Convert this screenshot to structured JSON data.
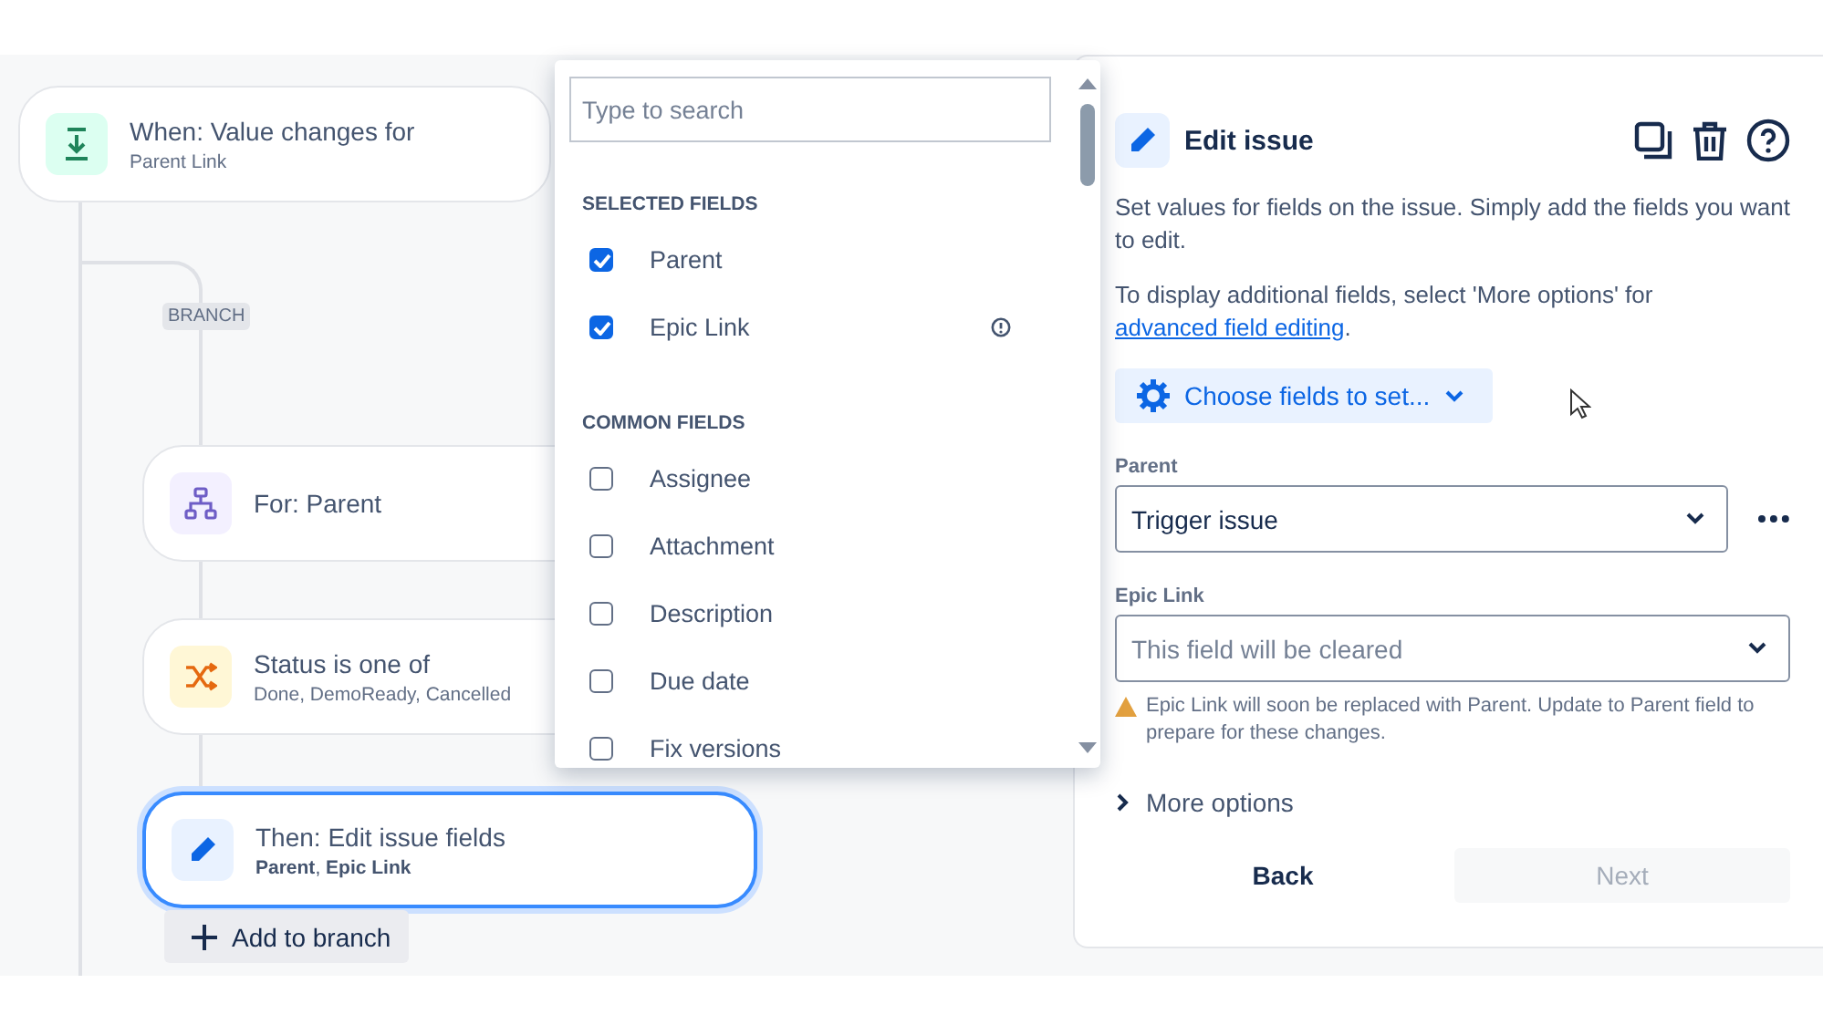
{
  "flow": {
    "trigger": {
      "title": "When: Value changes for",
      "subtitle": "Parent Link"
    },
    "branch_label": "BRANCH",
    "steps": [
      {
        "kind": "for",
        "title": "For: Parent",
        "selected": false
      },
      {
        "kind": "condition",
        "title": "Status is one of",
        "subtitle": "Done, DemoReady, Cancelled",
        "selected": false
      },
      {
        "kind": "action",
        "title": "Then: Edit issue fields",
        "subtitle": "**Parent**, **Epic Link**",
        "selected": true
      }
    ],
    "add_button": "Add to branch"
  },
  "field_picker": {
    "search": {
      "placeholder": "Type to search"
    },
    "sections": [
      {
        "heading": "SELECTED FIELDS",
        "items": [
          {
            "label": "Parent",
            "checked": true,
            "info": false
          },
          {
            "label": "Epic Link",
            "checked": true,
            "info": true
          }
        ]
      },
      {
        "heading": "COMMON FIELDS",
        "items": [
          {
            "label": "Assignee",
            "checked": false,
            "info": false
          },
          {
            "label": "Attachment",
            "checked": false,
            "info": false
          },
          {
            "label": "Description",
            "checked": false,
            "info": false
          },
          {
            "label": "Due date",
            "checked": false,
            "info": false
          },
          {
            "label": "Fix versions",
            "checked": false,
            "info": false
          }
        ]
      }
    ]
  },
  "panel": {
    "title": "Edit issue",
    "description": "Set values for fields on the issue. Simply add the fields you want to edit.",
    "note": "To display additional fields, select 'More options' for ",
    "note_link": "advanced field editing",
    "note_end": ".",
    "choose_button": "Choose fields to set...",
    "fields": [
      {
        "label": "Parent",
        "value": "Trigger issue",
        "more_menu": true
      },
      {
        "label": "Epic Link",
        "placeholder": "This field will be cleared",
        "more_menu": false,
        "warning": "Epic Link will soon be replaced with Parent. Update to Parent field to prepare for these changes."
      }
    ],
    "more_options": {
      "label": "More options",
      "expanded": false
    },
    "buttons": [
      {
        "label": "Back",
        "disabled": false
      },
      {
        "label": "Next",
        "disabled": true
      }
    ]
  }
}
